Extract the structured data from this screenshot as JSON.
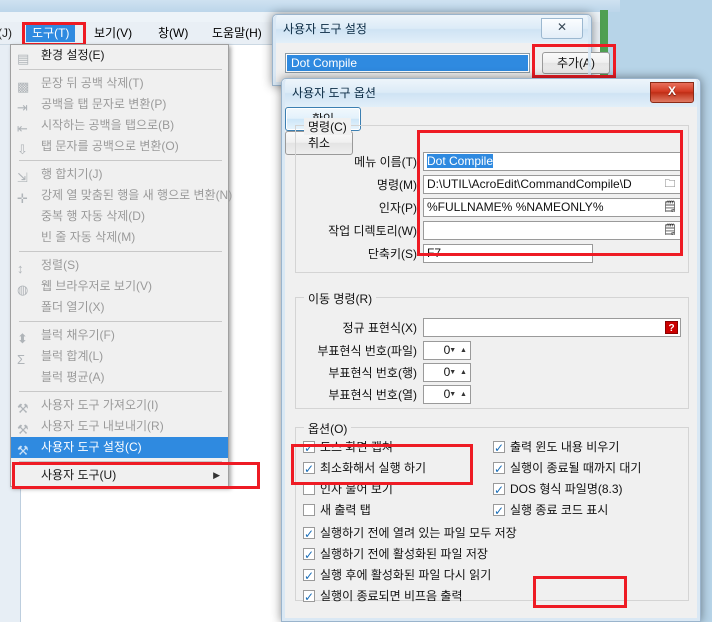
{
  "app": {
    "menubar": {
      "partial_item": "(J)",
      "items": [
        {
          "label": "도구(T)",
          "active": true
        },
        {
          "label": "보기(V)",
          "active": false
        },
        {
          "label": "창(W)",
          "active": false
        },
        {
          "label": "도움말(H)",
          "active": false
        }
      ]
    },
    "tools_menu": {
      "items": [
        {
          "label": "환경 설정(E)",
          "icon": "preferences-icon",
          "enabled": true,
          "selected": false,
          "separator_after": true
        },
        {
          "label": "문장 뒤 공백 삭제(T)",
          "icon": "trailing-space-icon",
          "enabled": false,
          "selected": false
        },
        {
          "label": "공백을 탭 문자로 변환(P)",
          "icon": "space-to-tab-icon",
          "enabled": false,
          "selected": false
        },
        {
          "label": "시작하는 공백을 탭으로(B)",
          "icon": "leading-space-to-tab-icon",
          "enabled": false,
          "selected": false
        },
        {
          "label": "탭 문자를 공백으로 변환(O)",
          "icon": "tab-to-space-icon",
          "enabled": false,
          "selected": false,
          "separator_after": true
        },
        {
          "label": "행 합치기(J)",
          "icon": "join-lines-icon",
          "enabled": false,
          "selected": false
        },
        {
          "label": "강제 열 맞춤된 행을 새 행으로 변환(N)",
          "icon": "crlf-icon",
          "enabled": false,
          "selected": false
        },
        {
          "label": "중복 행 자동 삭제(D)",
          "icon": "",
          "enabled": false,
          "selected": false
        },
        {
          "label": "빈 줄 자동 삭제(M)",
          "icon": "",
          "enabled": false,
          "selected": false,
          "separator_after": true
        },
        {
          "label": "정렬(S)",
          "icon": "sort-icon",
          "enabled": false,
          "selected": false
        },
        {
          "label": "웹 브라우저로 보기(V)",
          "icon": "globe-icon",
          "enabled": false,
          "selected": false
        },
        {
          "label": "폴더 열기(X)",
          "icon": "",
          "enabled": false,
          "selected": false,
          "separator_after": true
        },
        {
          "label": "블럭 채우기(F)",
          "icon": "block-fill-icon",
          "enabled": false,
          "selected": false
        },
        {
          "label": "블럭 합계(L)",
          "icon": "sigma-icon",
          "enabled": false,
          "selected": false
        },
        {
          "label": "블럭 평균(A)",
          "icon": "",
          "enabled": false,
          "selected": false,
          "separator_after": true
        },
        {
          "label": "사용자 도구 가져오기(I)",
          "icon": "tool-import-icon",
          "enabled": false,
          "selected": false
        },
        {
          "label": "사용자 도구 내보내기(R)",
          "icon": "tool-export-icon",
          "enabled": false,
          "selected": false
        },
        {
          "label": "사용자 도구 설정(C)",
          "icon": "tool-settings-icon",
          "enabled": true,
          "selected": true,
          "separator_after": true
        },
        {
          "label": "사용자 도구(U)",
          "icon": "",
          "enabled": true,
          "selected": false,
          "submenu": true
        }
      ]
    }
  },
  "dialog_tools": {
    "title": "사용자 도구 설정",
    "close_glyph": "✕",
    "list_selected_item": "Dot Compile",
    "add_button": "추가(A)"
  },
  "dialog_options": {
    "title": "사용자 도구 옵션",
    "close_glyph": "X",
    "group_command": {
      "legend": "명령(C)",
      "fields": [
        {
          "label": "메뉴 이름(T)",
          "value": "Dot Compile",
          "selected_text": true,
          "icon": ""
        },
        {
          "label": "명령(M)",
          "value": "D:\\UTIL\\AcroEdit\\CommandCompile\\D",
          "selected_text": false,
          "icon": "folder-icon"
        },
        {
          "label": "인자(P)",
          "value": "%FULLNAME% %NAMEONLY%",
          "selected_text": false,
          "icon": "insert-variable-icon"
        },
        {
          "label": "작업 디렉토리(W)",
          "value": "",
          "selected_text": false,
          "icon": "insert-variable-icon"
        },
        {
          "label": "단축키(S)",
          "value": "F7",
          "selected_text": false,
          "icon": ""
        }
      ]
    },
    "group_move": {
      "legend": "이동 명령(R)",
      "regex_label": "정규 표현식(X)",
      "regex_value": "",
      "help_glyph": "?",
      "spinners": [
        {
          "label": "부표현식 번호(파일)",
          "value": "0"
        },
        {
          "label": "부표현식 번호(행)",
          "value": "0"
        },
        {
          "label": "부표현식 번호(열)",
          "value": "0"
        }
      ]
    },
    "group_options": {
      "legend": "옵션(O)",
      "left_column": [
        {
          "label": "도스 화면 캡쳐",
          "checked": true
        },
        {
          "label": "최소화해서 실행 하기",
          "checked": true
        },
        {
          "label": "인자 물어 보기",
          "checked": false
        },
        {
          "label": "새 출력 탭",
          "checked": false
        }
      ],
      "right_column": [
        {
          "label": "출력 윈도 내용 비우기",
          "checked": true
        },
        {
          "label": "실행이 종료될 때까지 대기",
          "checked": true
        },
        {
          "label": "DOS 형식 파일명(8.3)",
          "checked": true
        },
        {
          "label": "실행 종료 코드 표시",
          "checked": true
        }
      ],
      "full_width": [
        {
          "label": "실행하기 전에 열려 있는 파일 모두 저장",
          "checked": true
        },
        {
          "label": "실행하기 전에 활성화된 파일 저장",
          "checked": true
        },
        {
          "label": "실행 후에 활성화된 파일 다시 읽기",
          "checked": true
        },
        {
          "label": "실행이 종료되면 비프음 출력",
          "checked": true
        }
      ]
    },
    "ok_button": "확인",
    "cancel_button": "취소"
  },
  "annotations": {
    "highlight_color": "#ee1b24",
    "boxes": [
      "menubar-tools",
      "menu-item-user-tool-settings",
      "add-button",
      "command-fields",
      "unchecked-options",
      "ok-button"
    ]
  }
}
